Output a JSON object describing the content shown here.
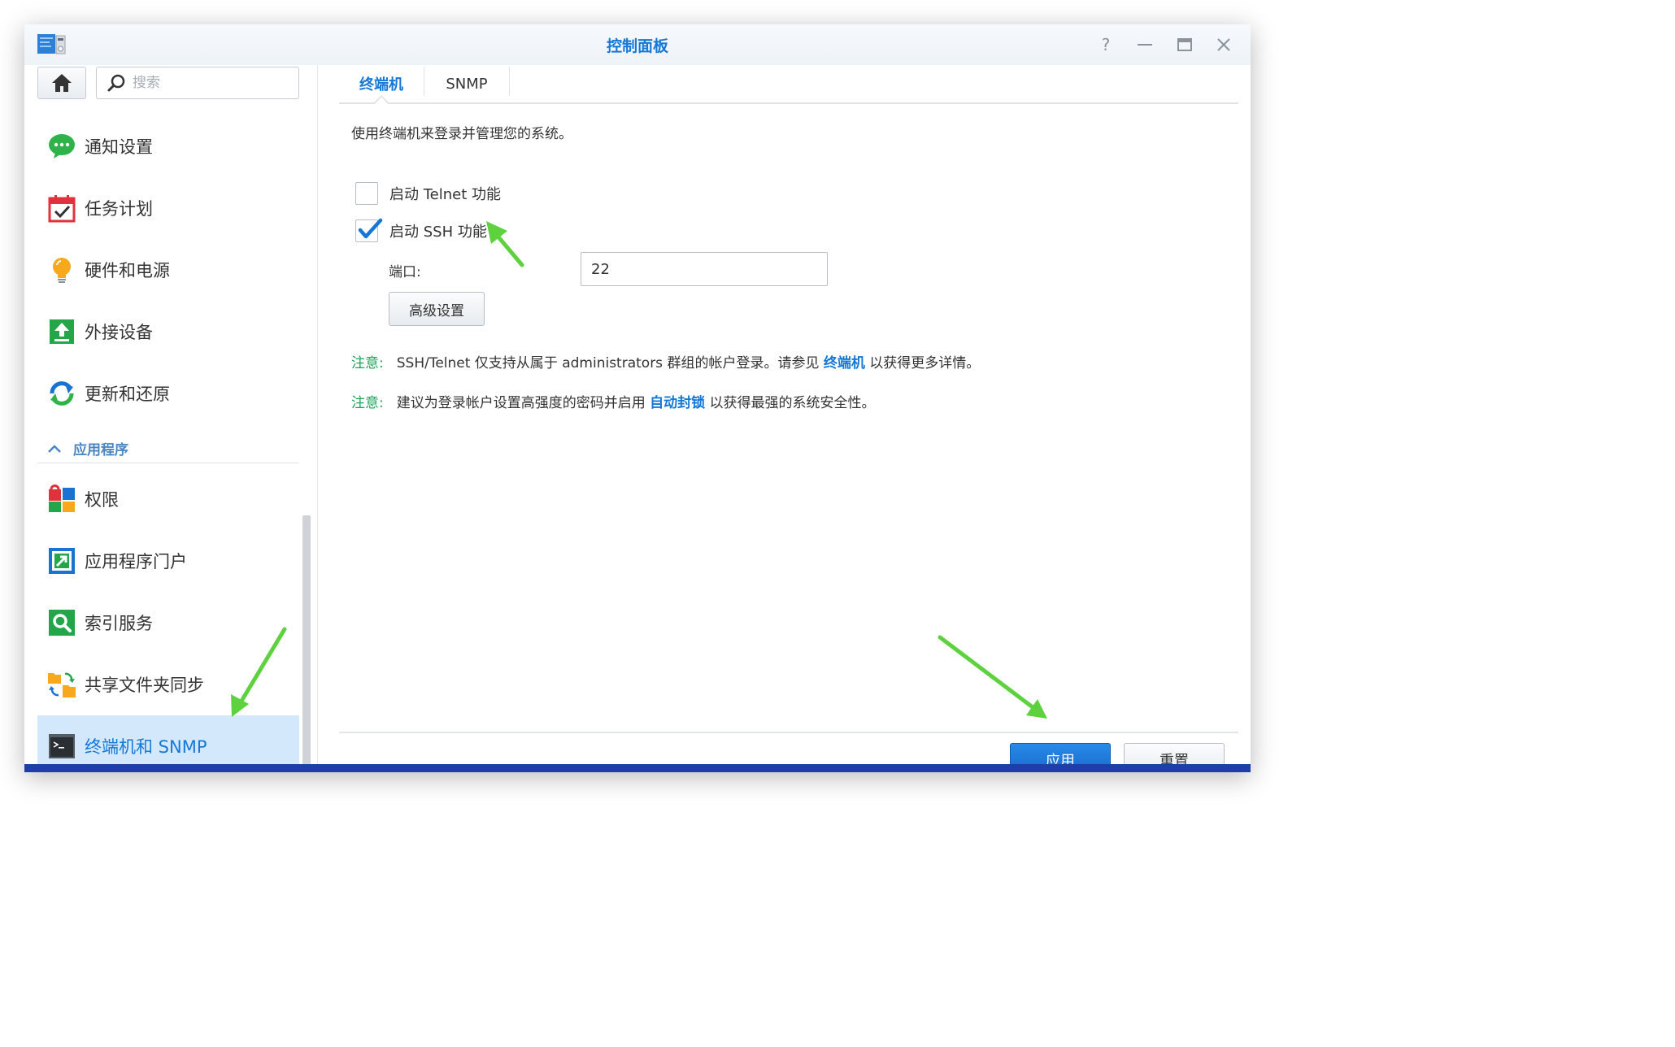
{
  "window": {
    "title": "控制面板",
    "controls": {
      "help": "?",
      "minimize": "—",
      "maximize": "▭",
      "close": "✕"
    }
  },
  "sidebar": {
    "search_placeholder": "搜索",
    "items": [
      {
        "label": "通知设置",
        "icon": "notification-icon"
      },
      {
        "label": "任务计划",
        "icon": "calendar-icon"
      },
      {
        "label": "硬件和电源",
        "icon": "lightbulb-icon"
      },
      {
        "label": "外接设备",
        "icon": "upload-icon"
      },
      {
        "label": "更新和还原",
        "icon": "refresh-icon"
      }
    ],
    "section": {
      "label": "应用程序",
      "icon": "chevron-up-icon"
    },
    "app_items": [
      {
        "label": "权限",
        "icon": "permissions-icon"
      },
      {
        "label": "应用程序门户",
        "icon": "portal-icon"
      },
      {
        "label": "索引服务",
        "icon": "index-icon"
      },
      {
        "label": "共享文件夹同步",
        "icon": "folder-sync-icon"
      },
      {
        "label": "终端机和 SNMP",
        "icon": "terminal-icon",
        "active": true
      }
    ]
  },
  "main": {
    "tabs": [
      {
        "label": "终端机",
        "active": true
      },
      {
        "label": "SNMP",
        "active": false
      }
    ],
    "description": "使用终端机来登录并管理您的系统。",
    "telnet": {
      "label": "启动 Telnet 功能",
      "checked": false
    },
    "ssh": {
      "label": "启动 SSH 功能",
      "checked": true
    },
    "port": {
      "label": "端口:",
      "value": "22"
    },
    "advanced_button": "高级设置",
    "notes": [
      {
        "tag": "注意:",
        "before": "SSH/Telnet 仅支持从属于 administrators 群组的帐户登录。请参见 ",
        "link": "终端机",
        "after": " 以获得更多详情。"
      },
      {
        "tag": "注意:",
        "before": "建议为登录帐户设置高强度的密码并启用 ",
        "link": "自动封锁",
        "after": " 以获得最强的系统安全性。"
      }
    ],
    "apply_button": "应用",
    "reset_button": "重置"
  },
  "colors": {
    "accent": "#1578d6",
    "note_tag": "#1ea45a",
    "active_row": "#d4e8fb",
    "annotation_arrow": "#5ed13f"
  }
}
